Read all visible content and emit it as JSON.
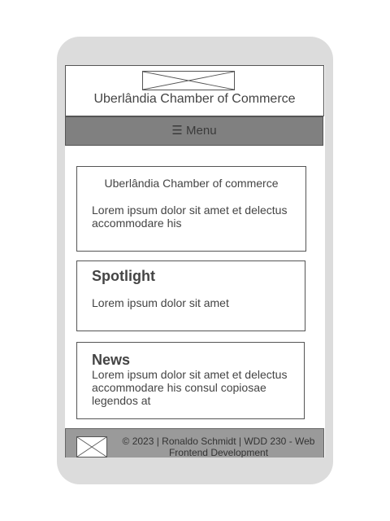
{
  "header": {
    "title": "Uberlândia Chamber of Commerce",
    "logo_icon": "image-placeholder-icon"
  },
  "nav": {
    "menu_label": "☰ Menu"
  },
  "cards": [
    {
      "title": "Uberlândia Chamber of commerce",
      "text": "Lorem ipsum dolor sit amet et delectus accommodare his"
    },
    {
      "title": "Spotlight",
      "text": "Lorem ipsum dolor sit amet"
    },
    {
      "title": "News",
      "text": "Lorem ipsum dolor sit amet et delectus accommodare his consul copiosae legendos at"
    }
  ],
  "footer": {
    "text": "© 2023 | Ronaldo Schmidt | WDD 230 - Web Frontend Development",
    "logo_icon": "image-placeholder-icon"
  },
  "colors": {
    "device_frame": "#dcdcdc",
    "menu_bar": "#808080",
    "footer": "#9a9a9a",
    "border": "#555555",
    "text": "#444444"
  }
}
